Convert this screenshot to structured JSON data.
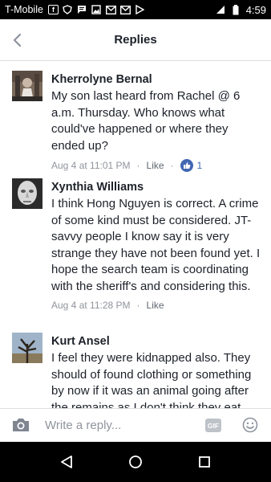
{
  "status_bar": {
    "carrier": "T-Mobile",
    "time": "4:59",
    "icons": [
      "facebook-icon",
      "shield-icon",
      "message-icon",
      "image-icon",
      "gmail-icon",
      "gmail-icon",
      "play-icon",
      "signal-icon",
      "battery-icon"
    ]
  },
  "header": {
    "title": "Replies",
    "back_icon": "back-icon"
  },
  "comments": [
    {
      "author": "Kherrolyne Bernal",
      "text": "My son last heard from Rachel @ 6 a.m. Thursday. Who knows what could've happened or where they ended up?",
      "time": "Aug 4 at 11:01 PM",
      "like_label": "Like",
      "reaction_count": "1"
    },
    {
      "author": "Xynthia Williams",
      "text": "I think Hong Nguyen is correct. A crime of some kind must be considered. JT-savvy people I know say it is very strange they have not been found yet. I hope the search team is coordinating with the sheriff's and considering this.",
      "time": "Aug 4 at 11:28 PM",
      "like_label": "Like"
    },
    {
      "author": "Kurt Ansel",
      "text": "I feel they were kidnapped also. They should of found clothing or something by now if it was an animal going after the remains as I don't think they eat"
    }
  ],
  "composer": {
    "placeholder": "Write a reply...",
    "gif_label": "GIF"
  },
  "colors": {
    "accent": "#4267b2",
    "text": "#1d2129",
    "meta": "#90949c",
    "divider": "#dddfe2"
  }
}
